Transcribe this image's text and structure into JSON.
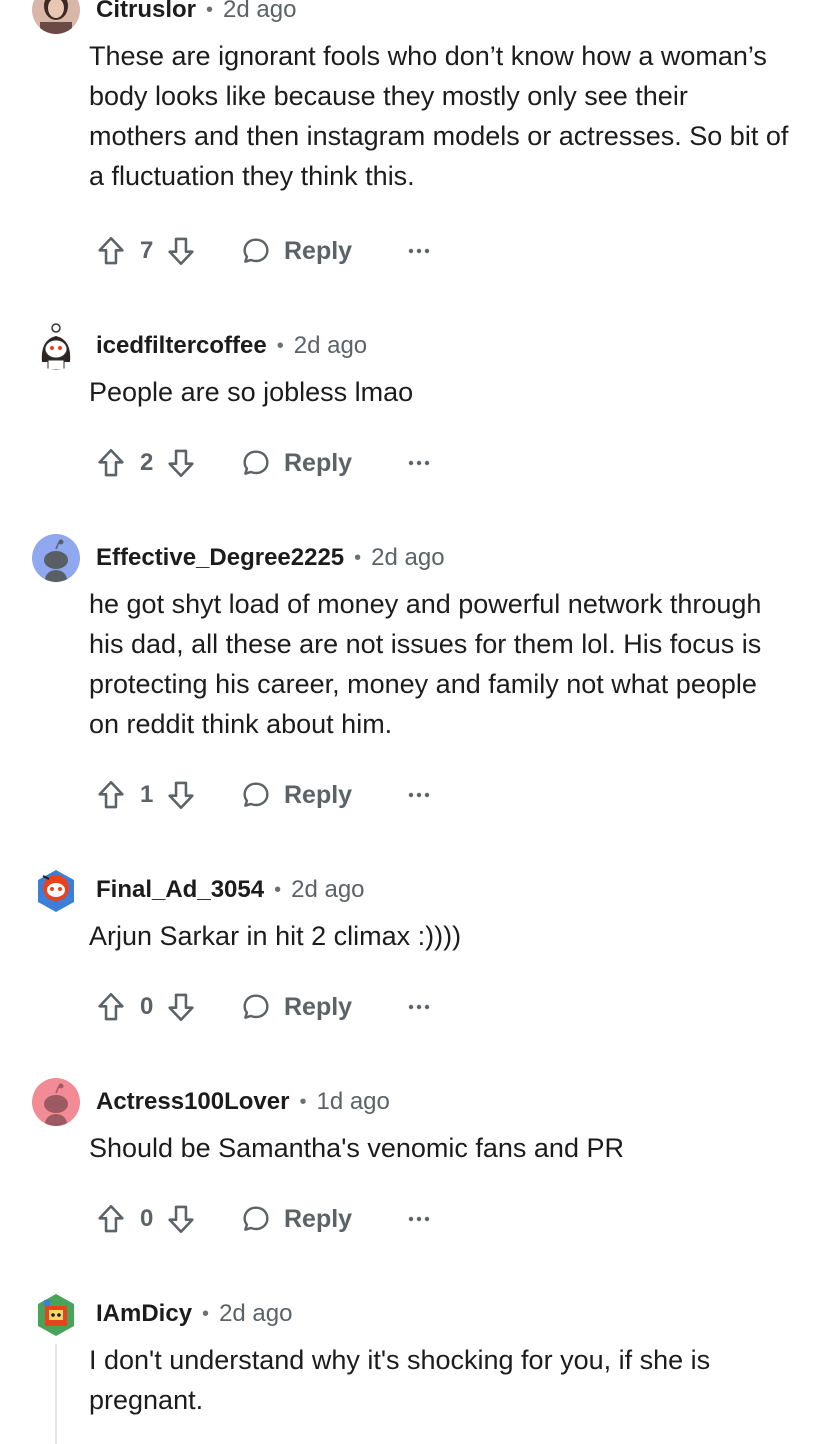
{
  "comments": [
    {
      "username": "Citruslor",
      "time": "2d ago",
      "avatar_icon": "profile-photo-icon",
      "text": "These are ignorant fools who don’t know how a woman’s body looks like because they mostly only see their mothers and then instagram models or actresses. So bit of a fluctuation they think this.",
      "score": "7",
      "reply_label": "Reply"
    },
    {
      "username": "icedfiltercoffee",
      "time": "2d ago",
      "avatar_icon": "snoo-avatar-icon",
      "text": "People are so jobless lmao",
      "score": "2",
      "reply_label": "Reply"
    },
    {
      "username": "Effective_Degree2225",
      "time": "2d ago",
      "avatar_icon": "default-snoo-avatar-icon",
      "text": "he got shyt load of money and powerful network through his dad, all these are not issues for them lol. His focus is protecting his career, money and family not what people on reddit think about him.",
      "score": "1",
      "reply_label": "Reply"
    },
    {
      "username": "Final_Ad_3054",
      "time": "2d ago",
      "avatar_icon": "snoo-avatar-icon",
      "text": "Arjun Sarkar in hit 2 climax :))))",
      "score": "0",
      "reply_label": "Reply"
    },
    {
      "username": "Actress100Lover",
      "time": "1d ago",
      "avatar_icon": "default-snoo-avatar-icon",
      "text": "Should be Samantha's venomic fans and PR",
      "score": "0",
      "reply_label": "Reply"
    },
    {
      "username": "IAmDicy",
      "time": "2d ago",
      "avatar_icon": "snoo-avatar-icon",
      "text": "I don't understand why it's shocking for you, if she is pregnant."
    }
  ],
  "separator": "•",
  "colors": {
    "text": "#1c1c1c",
    "meta": "#5c6266",
    "avatar_blue": "#8fa8f0",
    "avatar_pink": "#f28b96",
    "thread_line": "#e3e5e6"
  }
}
